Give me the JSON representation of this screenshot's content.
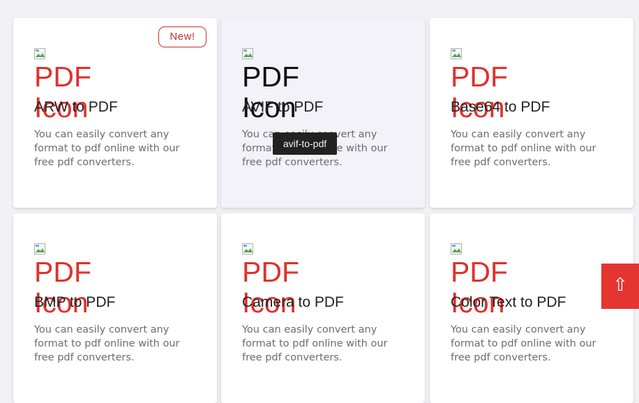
{
  "cards": [
    {
      "alt": "PDF Icon",
      "title": "ARW to PDF",
      "desc": "You can easily convert any format to pdf online with our free pdf converters.",
      "badge": "New!"
    },
    {
      "alt": "PDF Icon",
      "title": "AVIF to PDF",
      "desc": "You can easily convert any format to pdf online with our free pdf converters."
    },
    {
      "alt": "PDF Icon",
      "title": "Base64 to PDF",
      "desc": "You can easily convert any format to pdf online with our free pdf converters."
    },
    {
      "alt": "PDF Icon",
      "title": "BMP to PDF",
      "desc": "You can easily convert any format to pdf online with our free pdf converters."
    },
    {
      "alt": "PDF Icon",
      "title": "Camera to PDF",
      "desc": "You can easily convert any format to pdf online with our free pdf converters."
    },
    {
      "alt": "PDF Icon",
      "title": "Color Text to PDF",
      "desc": "You can easily convert any format to pdf online with our free pdf converters."
    }
  ],
  "tooltip": "avif-to-pdf",
  "scroll_top_icon": "⇧",
  "colors": {
    "accent": "#e53530",
    "alt_text": "#e0312c",
    "badge": "#c9302c"
  }
}
